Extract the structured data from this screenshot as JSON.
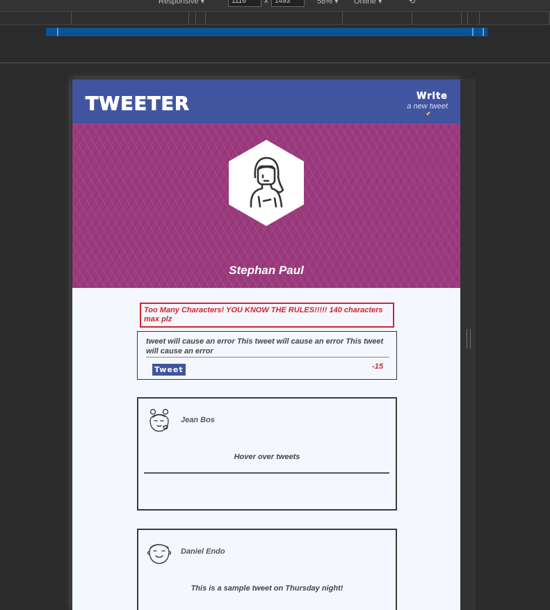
{
  "devtools": {
    "device": "Responsive",
    "width": "1116",
    "times": "x",
    "height": "1493",
    "zoom": "58%",
    "throttle": "Online"
  },
  "header": {
    "logo": "Tweeter",
    "write_label": "Write",
    "write_sub": "a new tweet",
    "brand_color": "#4054a0"
  },
  "profile": {
    "name": "Stephan Paul",
    "banner_color": "#9b3a7d"
  },
  "composer": {
    "error": "Too Many Characters! YOU KNOW THE RULES!!!!! 140 characters max plz",
    "text": "tweet will cause an error This tweet will cause an error This tweet will cause an error",
    "button_label": "Tweet",
    "char_count": "-15"
  },
  "tweets": [
    {
      "author": "Jean Bos",
      "body": "Hover over tweets",
      "avatar_icon": "girl-avatar-icon"
    },
    {
      "author": "Daniel Endo",
      "body": "This is a sample tweet on Thursday night!",
      "avatar_icon": "boy-avatar-icon"
    }
  ]
}
